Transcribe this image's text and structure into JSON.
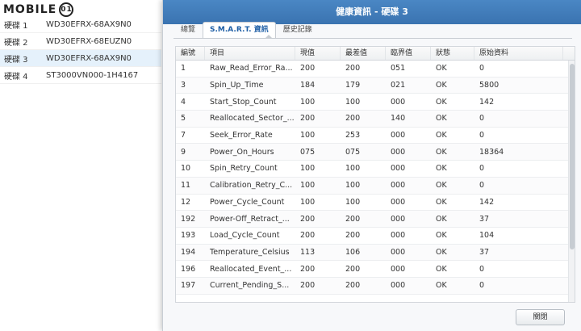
{
  "logo": {
    "text": "MOBILE",
    "badge": "01"
  },
  "disks": [
    {
      "name": "硬碟 1",
      "model": "WD30EFRX-68AX9N0"
    },
    {
      "name": "硬碟 2",
      "model": "WD30EFRX-68EUZN0"
    },
    {
      "name": "硬碟 3",
      "model": "WD30EFRX-68AX9N0"
    },
    {
      "name": "硬碟 4",
      "model": "ST3000VN000-1H4167"
    }
  ],
  "dialog": {
    "title": "健康資訊 - 硬碟 3",
    "tabs": [
      "總覽",
      "S.M.A.R.T. 資訊",
      "歷史記錄"
    ],
    "active_tab": 1,
    "columns": [
      "編號",
      "項目",
      "現值",
      "最差值",
      "臨界值",
      "狀態",
      "原始資料"
    ],
    "rows": [
      [
        "1",
        "Raw_Read_Error_Ra...",
        "200",
        "200",
        "051",
        "OK",
        "0"
      ],
      [
        "3",
        "Spin_Up_Time",
        "184",
        "179",
        "021",
        "OK",
        "5800"
      ],
      [
        "4",
        "Start_Stop_Count",
        "100",
        "100",
        "000",
        "OK",
        "142"
      ],
      [
        "5",
        "Reallocated_Sector_...",
        "200",
        "200",
        "140",
        "OK",
        "0"
      ],
      [
        "7",
        "Seek_Error_Rate",
        "100",
        "253",
        "000",
        "OK",
        "0"
      ],
      [
        "9",
        "Power_On_Hours",
        "075",
        "075",
        "000",
        "OK",
        "18364"
      ],
      [
        "10",
        "Spin_Retry_Count",
        "100",
        "100",
        "000",
        "OK",
        "0"
      ],
      [
        "11",
        "Calibration_Retry_C...",
        "100",
        "100",
        "000",
        "OK",
        "0"
      ],
      [
        "12",
        "Power_Cycle_Count",
        "100",
        "100",
        "000",
        "OK",
        "142"
      ],
      [
        "192",
        "Power-Off_Retract_...",
        "200",
        "200",
        "000",
        "OK",
        "37"
      ],
      [
        "193",
        "Load_Cycle_Count",
        "200",
        "200",
        "000",
        "OK",
        "104"
      ],
      [
        "194",
        "Temperature_Celsius",
        "113",
        "106",
        "000",
        "OK",
        "37"
      ],
      [
        "196",
        "Reallocated_Event_...",
        "200",
        "200",
        "000",
        "OK",
        "0"
      ],
      [
        "197",
        "Current_Pending_S...",
        "200",
        "200",
        "000",
        "OK",
        "0"
      ]
    ],
    "close_label": "關閉"
  },
  "colors": {
    "title_bar": "#3a73b0",
    "selected_row": "#e5f1fb",
    "active_tab_text": "#1f5fa6"
  }
}
